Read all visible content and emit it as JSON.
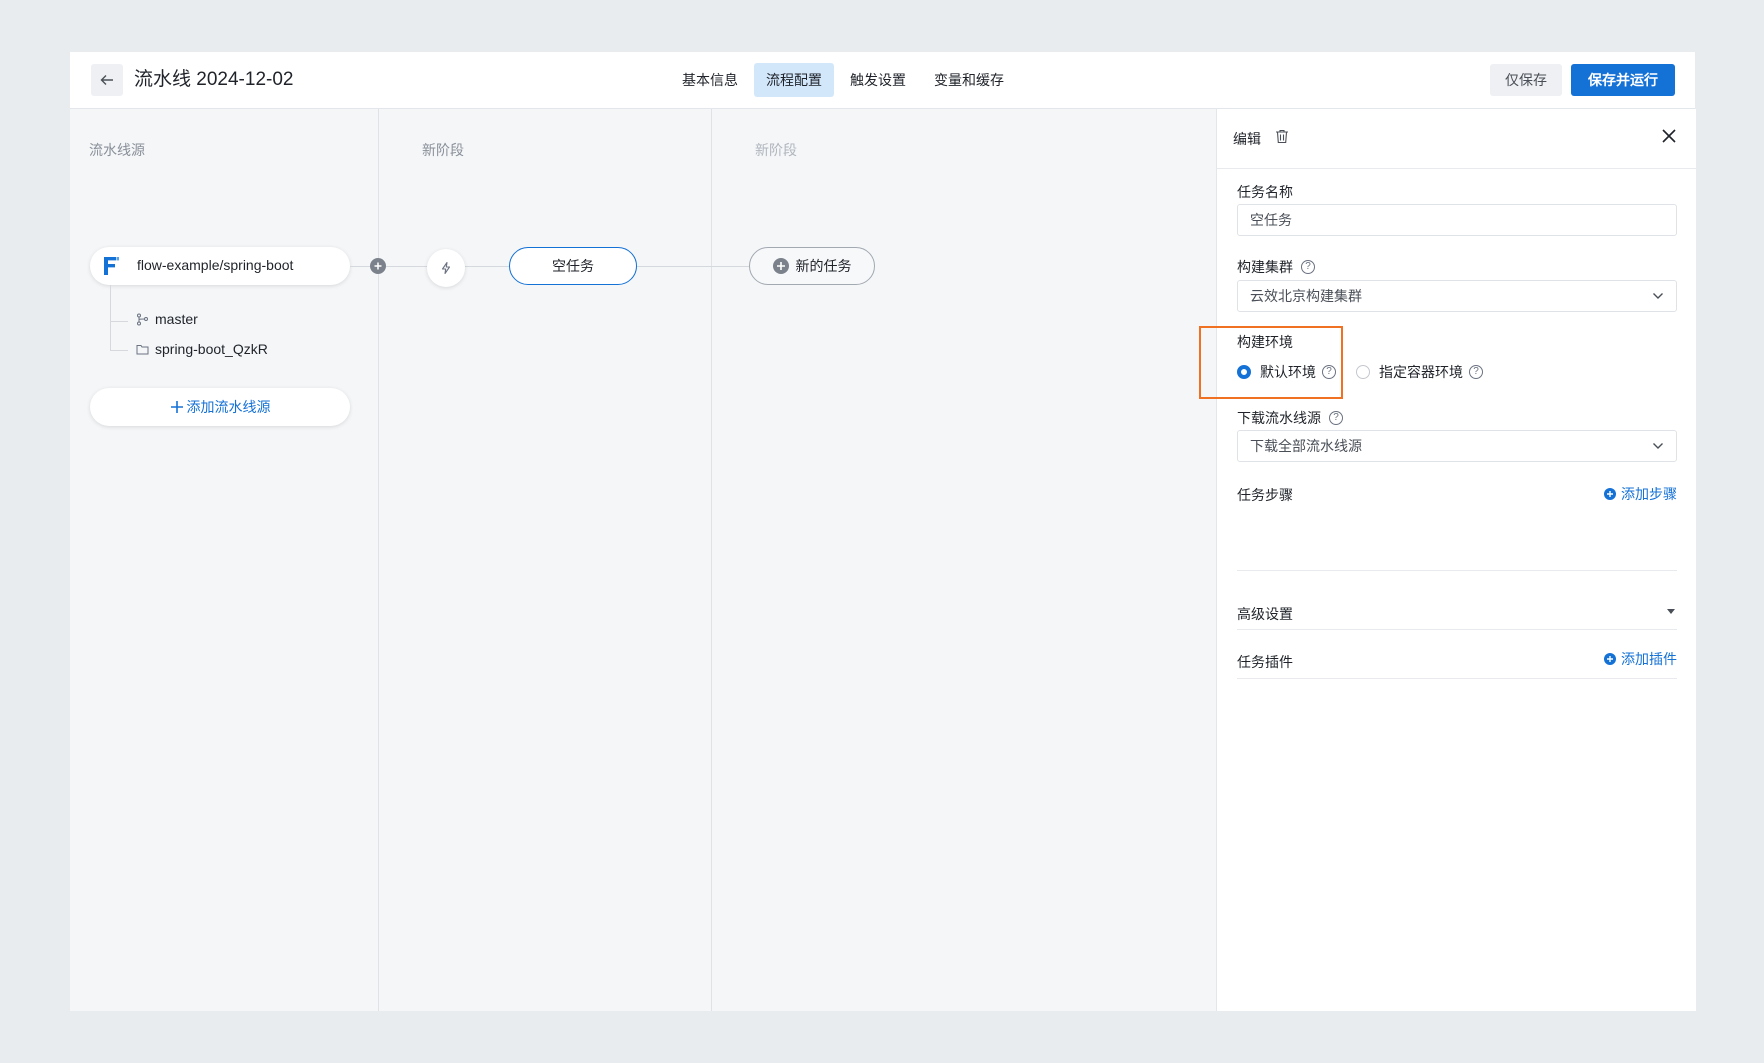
{
  "header": {
    "back_icon": "arrow-left-icon",
    "title": "流水线 2024-12-02",
    "tabs": [
      {
        "label": "基本信息",
        "active": false
      },
      {
        "label": "流程配置",
        "active": true
      },
      {
        "label": "触发设置",
        "active": false
      },
      {
        "label": "变量和缓存",
        "active": false
      }
    ],
    "save_only_label": "仅保存",
    "save_run_label": "保存并运行"
  },
  "canvas": {
    "columns": [
      {
        "label": "流水线源"
      },
      {
        "label": "新阶段"
      },
      {
        "label": "新阶段"
      }
    ],
    "source": {
      "name": "flow-example/spring-boot",
      "branch": "master",
      "workdir": "spring-boot_QzkR"
    },
    "add_source_label": "添加流水线源",
    "empty_task_label": "空任务",
    "new_task_label": "新的任务"
  },
  "panel": {
    "title": "编辑",
    "task_name": {
      "label": "任务名称",
      "value": "空任务"
    },
    "cluster": {
      "label": "构建集群",
      "value": "云效北京构建集群"
    },
    "environment": {
      "label": "构建环境",
      "options": [
        {
          "label": "默认环境",
          "selected": true
        },
        {
          "label": "指定容器环境",
          "selected": false
        }
      ]
    },
    "download": {
      "label": "下载流水线源",
      "value": "下载全部流水线源"
    },
    "steps": {
      "label": "任务步骤",
      "action": "添加步骤"
    },
    "advanced": {
      "label": "高级设置"
    },
    "plugins": {
      "label": "任务插件",
      "action": "添加插件"
    }
  },
  "colors": {
    "accent": "#1471d6",
    "highlight": "#f07122"
  }
}
